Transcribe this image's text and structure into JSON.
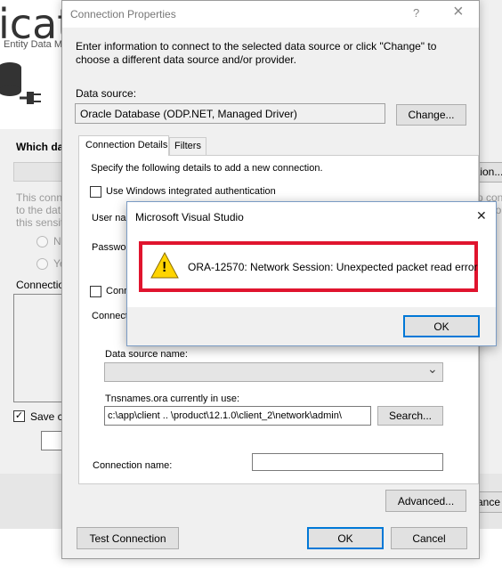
{
  "background": {
    "title_fragment": "icat",
    "subtitle_fragment": "Entity Data M",
    "which_label": "Which da",
    "desc_lines": [
      "This conn",
      "to the dat",
      "this sensit"
    ],
    "radio_1": "N",
    "radio_2": "Ye",
    "connection_label": "Connectio",
    "save_label": "Save co",
    "tion_button": "tion...",
    "right_text_1": "p con",
    "right_text_2": "a pro",
    "cancel_fragment": "ance"
  },
  "dialog": {
    "title": "Connection Properties",
    "help_glyph": "?",
    "close_glyph": "×",
    "intro": "Enter information to connect to the selected data source or click \"Change\" to choose a different data source and/or provider.",
    "data_source_label": "Data source:",
    "data_source_value": "Oracle Database (ODP.NET, Managed Driver)",
    "change_button": "Change...",
    "tabs": [
      {
        "label": "Connection Details"
      },
      {
        "label": "Filters"
      }
    ],
    "specify_text": "Specify the following details to add a new connection.",
    "windows_auth_label": "Use Windows integrated authentication",
    "user_name_label": "User nar",
    "password_label": "Passwor",
    "conn_check_label": "Conn",
    "connect_label": "Connect",
    "data_source_name_label": "Data source name:",
    "tnsnames_label": "Tnsnames.ora currently in use:",
    "tnsnames_value": "c:\\app\\client         ..  \\product\\12.1.0\\client_2\\network\\admin\\",
    "search_button": "Search...",
    "connection_name_label": "Connection name:",
    "connection_name_value": "",
    "advanced_button": "Advanced...",
    "test_connection_button": "Test Connection",
    "ok_button": "OK",
    "cancel_button": "Cancel",
    "dropdown_glyph": "⌄"
  },
  "error_box": {
    "title": "Microsoft Visual Studio",
    "close_glyph": "✕",
    "message": "ORA-12570: Network Session: Unexpected packet read error",
    "ok_button": "OK",
    "icon": "warning-icon",
    "icon_glyph": "!",
    "highlight_color": "#e0142e"
  },
  "colors": {
    "accent": "#0078d7",
    "warning": "#ffd400"
  }
}
